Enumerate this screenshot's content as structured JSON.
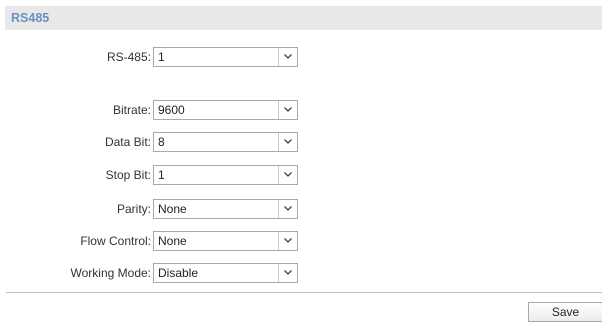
{
  "section": {
    "title": "RS485"
  },
  "fields": {
    "rs485": {
      "label": "RS-485:",
      "value": "1"
    },
    "bitrate": {
      "label": "Bitrate:",
      "value": "9600"
    },
    "data_bit": {
      "label": "Data Bit:",
      "value": "8"
    },
    "stop_bit": {
      "label": "Stop Bit:",
      "value": "1"
    },
    "parity": {
      "label": "Parity:",
      "value": "None"
    },
    "flow_control": {
      "label": "Flow Control:",
      "value": "None"
    },
    "working_mode": {
      "label": "Working Mode:",
      "value": "Disable"
    }
  },
  "actions": {
    "save_label": "Save"
  },
  "colors": {
    "header_bg": "#e8e8e8",
    "header_title": "#6d8fc3",
    "border": "#a9a9a9"
  },
  "icons": {
    "select_arrow": "chevron-down-icon"
  }
}
